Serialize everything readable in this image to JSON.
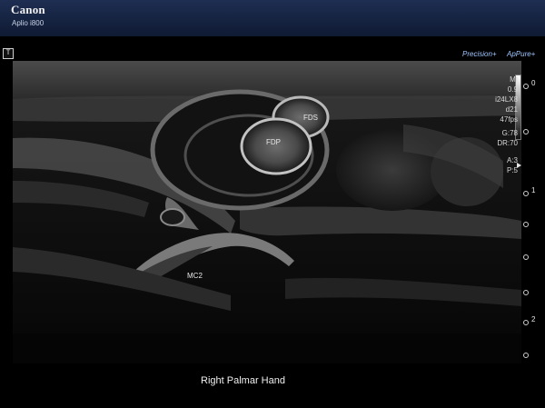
{
  "header": {
    "brand": "Canon",
    "model": "Aplio i800"
  },
  "overlay": {
    "t_marker": "T",
    "precision_label": "Precision+",
    "apure_label": "ApPure+"
  },
  "params": {
    "lines": [
      "MI",
      "0.9",
      "i24LX8",
      "d21",
      "47fps",
      "G:78",
      "DR:70",
      "A:3",
      "P:5"
    ]
  },
  "depth_scale": {
    "labels": [
      "0",
      "1",
      "2"
    ]
  },
  "annotations": {
    "fds": "FDS",
    "fdp": "FDP",
    "mc2": "MC2"
  },
  "caption": "Right Palmar Hand",
  "colors": {
    "header_top": "#1e2e52",
    "header_bottom": "#0f1a33",
    "logo_accent": "#9fc6ff"
  }
}
